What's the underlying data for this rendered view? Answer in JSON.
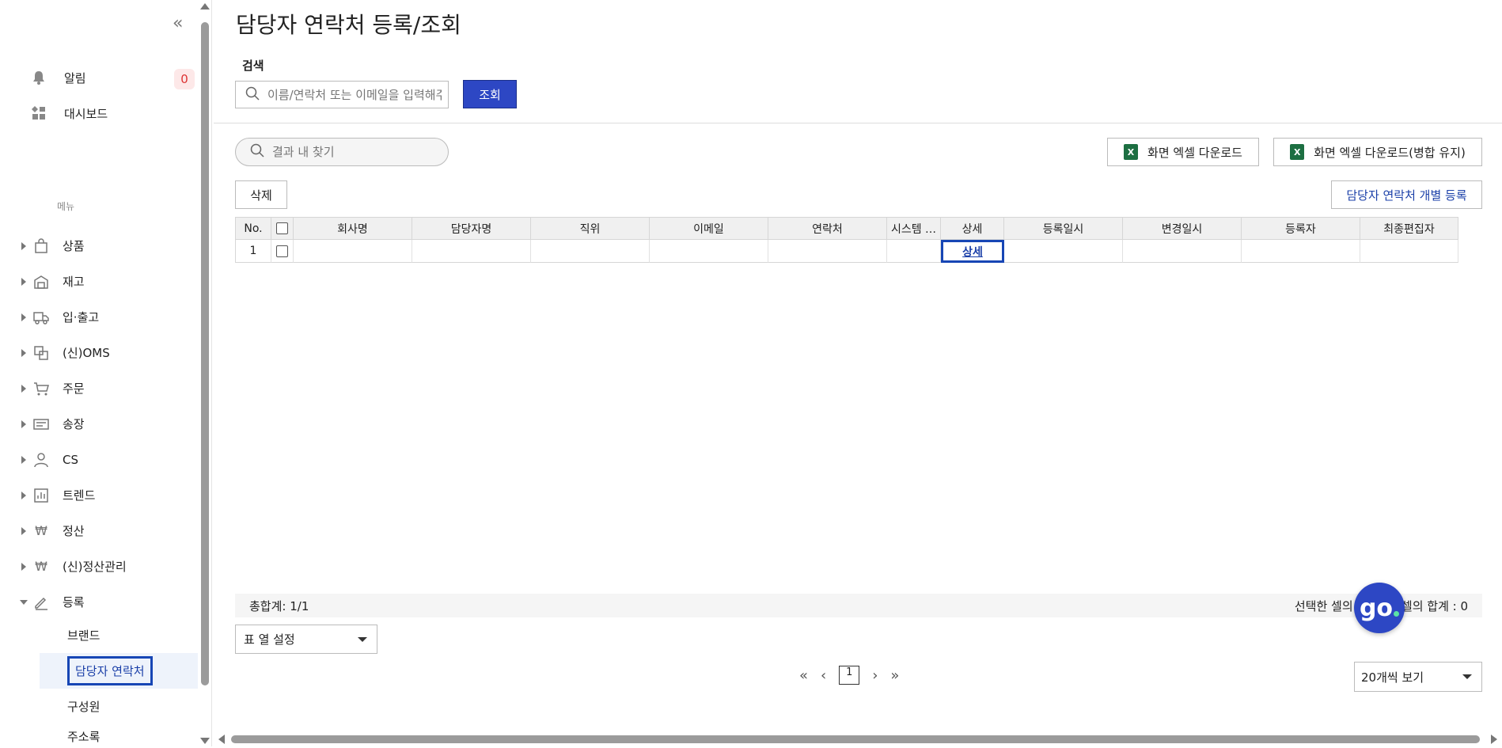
{
  "sidebar": {
    "collapse_icon": "double-chevron-left-icon",
    "top_items": [
      {
        "label": "알림",
        "icon": "bell-icon",
        "count": "0"
      },
      {
        "label": "대시보드",
        "icon": "dashboard-icon"
      }
    ],
    "menu_caption": "메뉴",
    "menu_items": [
      {
        "label": "상품",
        "icon": "bag-icon"
      },
      {
        "label": "재고",
        "icon": "warehouse-icon"
      },
      {
        "label": "입·출고",
        "icon": "truck-icon"
      },
      {
        "label": "(신)OMS",
        "icon": "oms-icon"
      },
      {
        "label": "주문",
        "icon": "cart-icon"
      },
      {
        "label": "송장",
        "icon": "invoice-icon"
      },
      {
        "label": "CS",
        "icon": "person-icon"
      },
      {
        "label": "트렌드",
        "icon": "chart-icon"
      },
      {
        "label": "정산",
        "icon": "won-icon"
      },
      {
        "label": "(신)정산관리",
        "icon": "won-icon"
      },
      {
        "label": "등록",
        "icon": "pencil-icon"
      }
    ],
    "sub_items": [
      {
        "label": "브랜드"
      },
      {
        "label": "담당자 연락처"
      },
      {
        "label": "구성원"
      },
      {
        "label": "주소록"
      }
    ]
  },
  "page": {
    "title": "담당자 연락처 등록/조회",
    "search_label": "검색",
    "search_placeholder": "이름/연락처 또는 이메일을 입력해주세요",
    "query_button": "조회",
    "result_search_placeholder": "결과 내 찾기",
    "excel_download": "화면 엑셀 다운로드",
    "excel_download_merge": "화면 엑셀 다운로드(병합 유지)",
    "excel_icon_text": "X",
    "delete_button": "삭제",
    "register_button": "담당자 연락처 개별 등록"
  },
  "grid": {
    "columns": [
      "No.",
      "",
      "회사명",
      "담당자명",
      "직위",
      "이메일",
      "연락처",
      "시스템 …",
      "상세",
      "등록일시",
      "변경일시",
      "등록자",
      "최종편집자"
    ],
    "rows": [
      {
        "no": "1",
        "company": "",
        "manager": "",
        "position": "",
        "email": "",
        "phone": "",
        "system": "",
        "detail": "상세",
        "registered": "",
        "modified": "",
        "registrant": "",
        "editor": ""
      }
    ]
  },
  "summary": {
    "total": "총합계: 1/1",
    "selection": "선택한 셀의 개수 : 0 셀의 합계 : 0"
  },
  "footer": {
    "column_setting": "표 열 설정",
    "current_page": "1",
    "page_size": "20개씩 보기"
  },
  "chat": {
    "label": "go"
  },
  "colors": {
    "accent": "#2d47c4",
    "highlight": "#1746b5"
  }
}
